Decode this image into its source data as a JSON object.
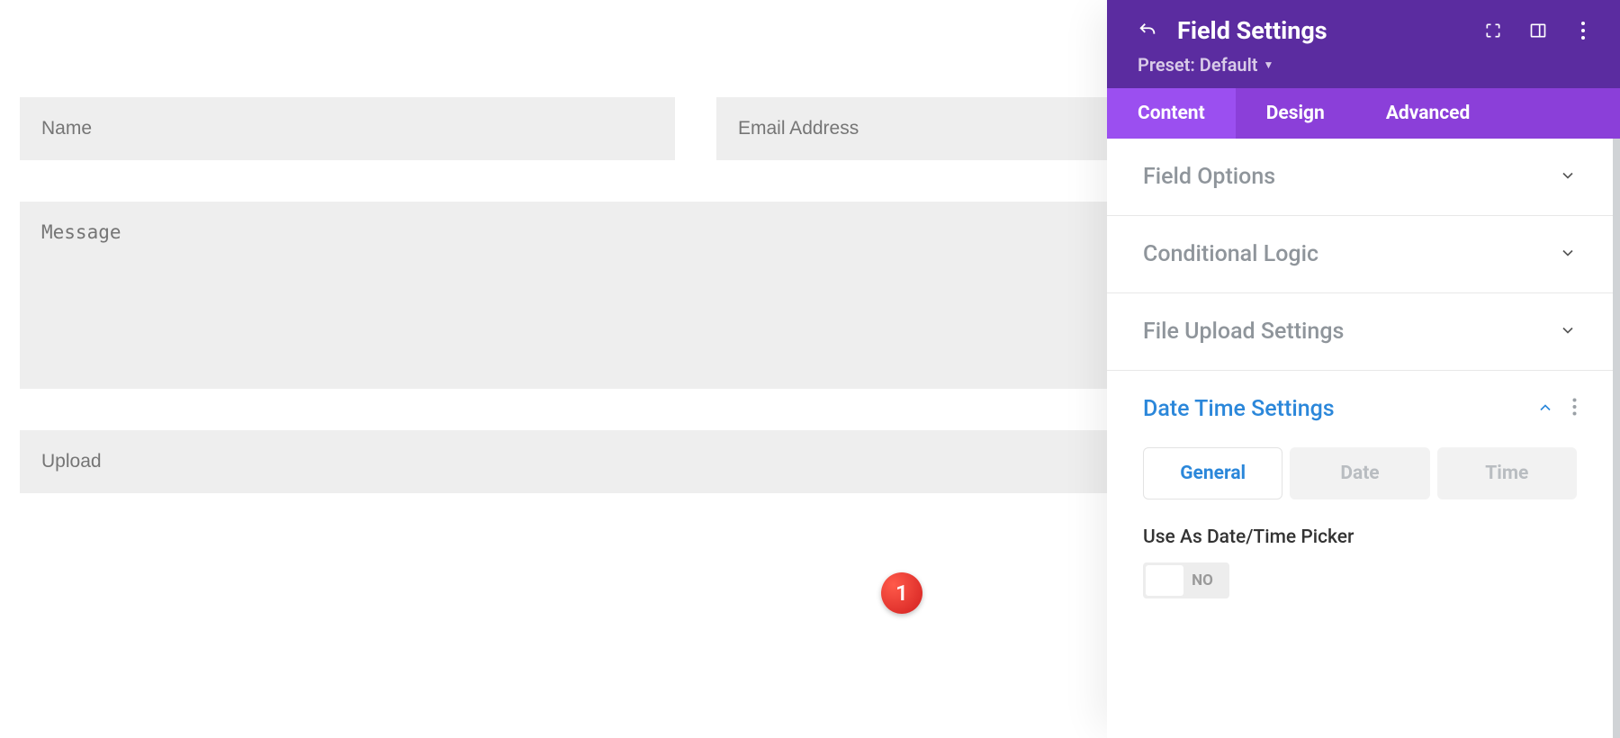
{
  "form": {
    "name_placeholder": "Name",
    "email_placeholder": "Email Address",
    "message_placeholder": "Message",
    "upload_placeholder": "Upload"
  },
  "panel": {
    "title": "Field Settings",
    "preset_label": "Preset: Default",
    "tabs": {
      "content": "Content",
      "design": "Design",
      "advanced": "Advanced"
    },
    "sections": {
      "field_options": "Field Options",
      "conditional_logic": "Conditional Logic",
      "file_upload_settings": "File Upload Settings",
      "date_time_settings": "Date Time Settings"
    },
    "subtabs": {
      "general": "General",
      "date": "Date",
      "time": "Time"
    },
    "settings": {
      "use_as_picker_label": "Use As Date/Time Picker",
      "toggle_no": "NO"
    }
  },
  "annotation": {
    "badge_1": "1"
  }
}
